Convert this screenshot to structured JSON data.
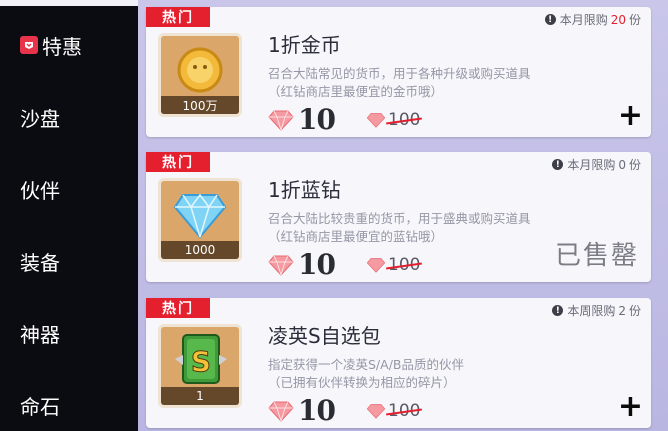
{
  "sidebar": {
    "items": [
      {
        "label": "特惠",
        "active": true,
        "icon": "tag-icon"
      },
      {
        "label": "沙盘"
      },
      {
        "label": "伙伴"
      },
      {
        "label": "装备"
      },
      {
        "label": "神器"
      },
      {
        "label": "命石"
      }
    ]
  },
  "products": [
    {
      "badge": "热门",
      "title": "1折金币",
      "desc1": "召合大陆常见的货币，用于各种升级或购买道具",
      "desc2": "（红钻商店里最便宜的金币哦）",
      "limit_prefix": "本月限购",
      "limit_count": "20",
      "limit_suffix": "份",
      "price": "10",
      "original_price": "100",
      "thumb_qty": "100万",
      "action": "+",
      "icon": "gold-coin-icon"
    },
    {
      "badge": "热门",
      "title": "1折蓝钻",
      "desc1": "召合大陆比较贵重的货币，用于盛典或购买道具",
      "desc2": "（红钻商店里最便宜的蓝钻哦）",
      "limit_prefix": "本月限购",
      "limit_count": "0",
      "limit_suffix": "份",
      "price": "10",
      "original_price": "100",
      "thumb_qty": "1000",
      "status": "已售罄",
      "icon": "blue-diamond-icon"
    },
    {
      "badge": "热门",
      "title": "凌英S自选包",
      "desc1": "指定获得一个凌英S/A/B品质的伙伴",
      "desc2": "（已拥有伙伴转换为相应的碎片）",
      "limit_prefix": "本周限购",
      "limit_count": "2",
      "limit_suffix": "份",
      "price": "10",
      "original_price": "100",
      "thumb_qty": "1",
      "action": "+",
      "icon": "s-card-icon"
    }
  ],
  "colors": {
    "accent_red": "#e4202f",
    "sidebar_bg": "#0b0b12",
    "card_bg": "#f7f7fb",
    "background": "#c9c6ea"
  }
}
